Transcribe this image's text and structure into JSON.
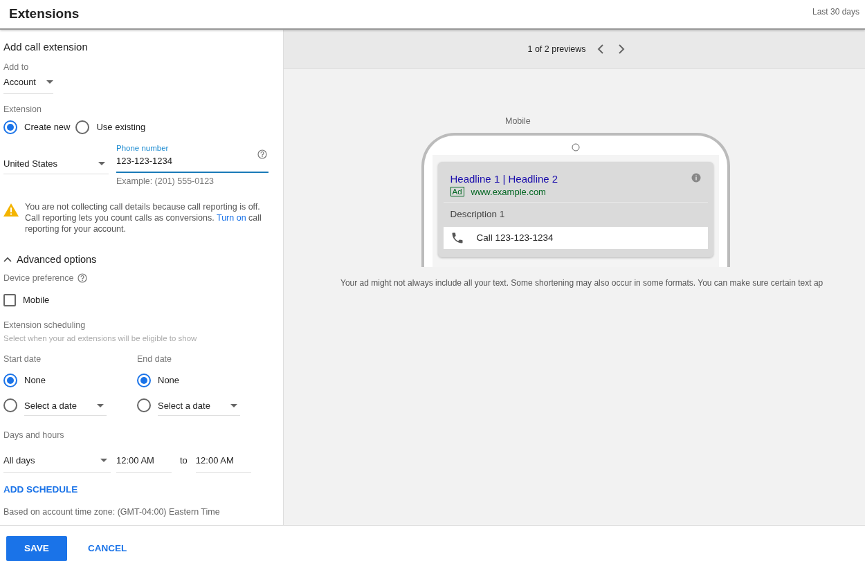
{
  "header": {
    "title": "Extensions",
    "period": "Last 30 days"
  },
  "form": {
    "heading": "Add call extension",
    "add_to": {
      "label": "Add to",
      "value": "Account"
    },
    "extension": {
      "label": "Extension",
      "options": [
        {
          "label": "Create new",
          "selected": true
        },
        {
          "label": "Use existing",
          "selected": false
        }
      ]
    },
    "phone": {
      "country": "United States",
      "label": "Phone number",
      "value": "123-123-1234",
      "hint": "Example: (201) 555-0123"
    },
    "warning": {
      "before": "You are not collecting call details because call reporting is off. Call reporting lets you count calls as conversions. ",
      "link": "Turn on",
      "after": " call reporting for your account."
    },
    "advanced": {
      "label": "Advanced options",
      "expanded": true
    },
    "device": {
      "label": "Device preference",
      "options": [
        {
          "label": "Mobile",
          "checked": false
        }
      ]
    },
    "scheduling": {
      "label": "Extension scheduling",
      "hint": "Select when your ad extensions will be eligible to show"
    },
    "dates": [
      {
        "label": "Start date",
        "options": [
          {
            "label": "None",
            "selected": true,
            "kind": "plain"
          },
          {
            "label": "Select a date",
            "selected": false,
            "kind": "dropdown"
          }
        ]
      },
      {
        "label": "End date",
        "options": [
          {
            "label": "None",
            "selected": true,
            "kind": "plain"
          },
          {
            "label": "Select a date",
            "selected": false,
            "kind": "dropdown"
          }
        ]
      }
    ],
    "days_hours": {
      "label": "Days and hours",
      "days": "All days",
      "from": "12:00 AM",
      "to_label": "to",
      "to": "12:00 AM"
    },
    "add_schedule": "ADD SCHEDULE",
    "timezone_note": "Based on account time zone: (GMT-04:00) Eastern Time"
  },
  "preview": {
    "counter": "1 of 2 previews",
    "device_label": "Mobile",
    "ad": {
      "headline": "Headline 1 | Headline 2",
      "badge": "Ad",
      "url": "www.example.com",
      "description": "Description 1",
      "call": "Call 123-123-1234"
    },
    "note": "Your ad might not always include all your text. Some shortening may also occur in some formats. You can make sure certain text ap"
  },
  "buttons": {
    "save": "SAVE",
    "cancel": "CANCEL"
  }
}
